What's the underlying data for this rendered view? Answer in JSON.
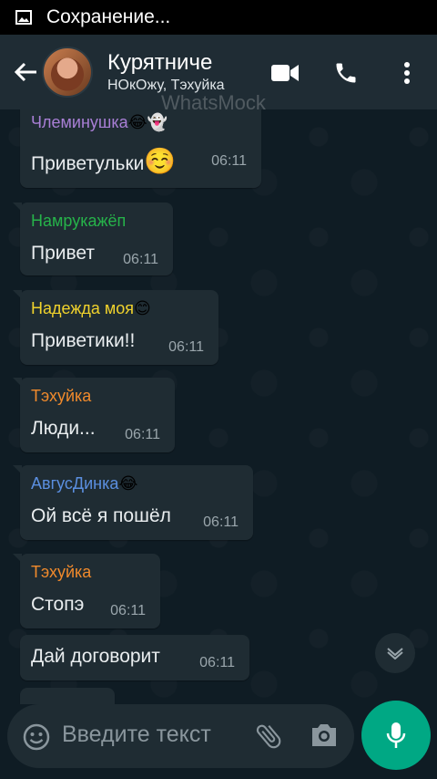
{
  "status_bar": {
    "text": "Сохранение...",
    "icon": "image-icon"
  },
  "header": {
    "title": "Курятниче",
    "subtitle": "НОкОжу, Тэхуйка",
    "watermark": "WhatsMock",
    "icons": [
      "back-arrow-icon",
      "video-call-icon",
      "phone-call-icon",
      "more-options-icon"
    ]
  },
  "messages": [
    {
      "sender": "Члеминушка",
      "sender_suffix": "😂👻",
      "sender_color": "#a97fd6",
      "text": "Приветульки",
      "text_suffix": "☺️",
      "time": "06:11"
    },
    {
      "sender": "Намрукажёп",
      "sender_suffix": "",
      "sender_color": "#26b34a",
      "text": "Привет",
      "text_suffix": "",
      "time": "06:11"
    },
    {
      "sender": "Надежда моя",
      "sender_suffix": "😊",
      "sender_color": "#f1d32c",
      "text": "Приветики!!",
      "text_suffix": "",
      "time": "06:11"
    },
    {
      "sender": "Тэхуйка",
      "sender_suffix": "",
      "sender_color": "#f08a2c",
      "text": "Люди...",
      "text_suffix": "",
      "time": "06:11"
    },
    {
      "sender": "АвгусДинка",
      "sender_suffix": "😂",
      "sender_color": "#5b8fe0",
      "text": "Ой всё я пошёл",
      "text_suffix": "",
      "time": "06:11"
    },
    {
      "sender": "Тэхуйка",
      "sender_suffix": "",
      "sender_color": "#f08a2c",
      "text": "Стопэ",
      "text_suffix": "",
      "time": "06:11"
    },
    {
      "sender": "",
      "sender_suffix": "",
      "sender_color": "",
      "text": "Дай договорит",
      "text_suffix": "",
      "time": "06:11"
    }
  ],
  "input": {
    "placeholder": "Введите текст"
  },
  "colors": {
    "accent": "#00a884",
    "header_bg": "#1f2c34",
    "bubble_bg": "#1f2c33"
  }
}
